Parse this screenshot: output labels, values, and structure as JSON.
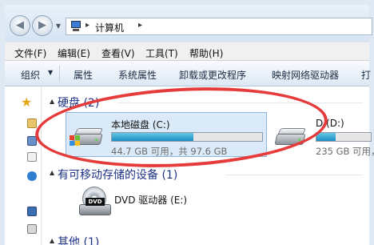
{
  "address_bar": {
    "location_icon": "computer-icon",
    "separator": "▸",
    "location": "计算机",
    "trailing_arrow": "▸",
    "back_icon": "arrow-left-icon",
    "forward_icon": "arrow-right-icon",
    "dropdown_icon": "chevron-down-icon"
  },
  "menu": {
    "items": [
      "文件(F)",
      "编辑(E)",
      "查看(V)",
      "工具(T)",
      "帮助(H)"
    ]
  },
  "commands": {
    "organize": "组织",
    "properties": "属性",
    "system_properties": "系统属性",
    "uninstall": "卸载或更改程序",
    "map_drive": "映射网络驱动器",
    "open_partial": "打"
  },
  "navpane": {
    "favorites_icon": "star-icon"
  },
  "groups": {
    "hard_disks": {
      "title": "硬盘 (2)"
    },
    "removable": {
      "title": "有可移动存储的设备 (1)"
    },
    "other": {
      "title": "其他 (1)"
    }
  },
  "drives": {
    "c": {
      "name": "本地磁盘 (C:)",
      "info": "44.7 GB 可用，共 97.6 GB",
      "used_fraction": 0.542,
      "icon": "hard-drive-windows-icon"
    },
    "d": {
      "name": "D (D:)",
      "info": "235 GB 可用，",
      "used_fraction": 0.35,
      "icon": "hard-drive-icon"
    },
    "e": {
      "name": "DVD 驱动器 (E:)",
      "icon": "dvd-drive-icon"
    }
  },
  "colors": {
    "annotation": "#e53b3b",
    "group_title": "#1e3287",
    "bar_fill": "#1a8fc2"
  }
}
